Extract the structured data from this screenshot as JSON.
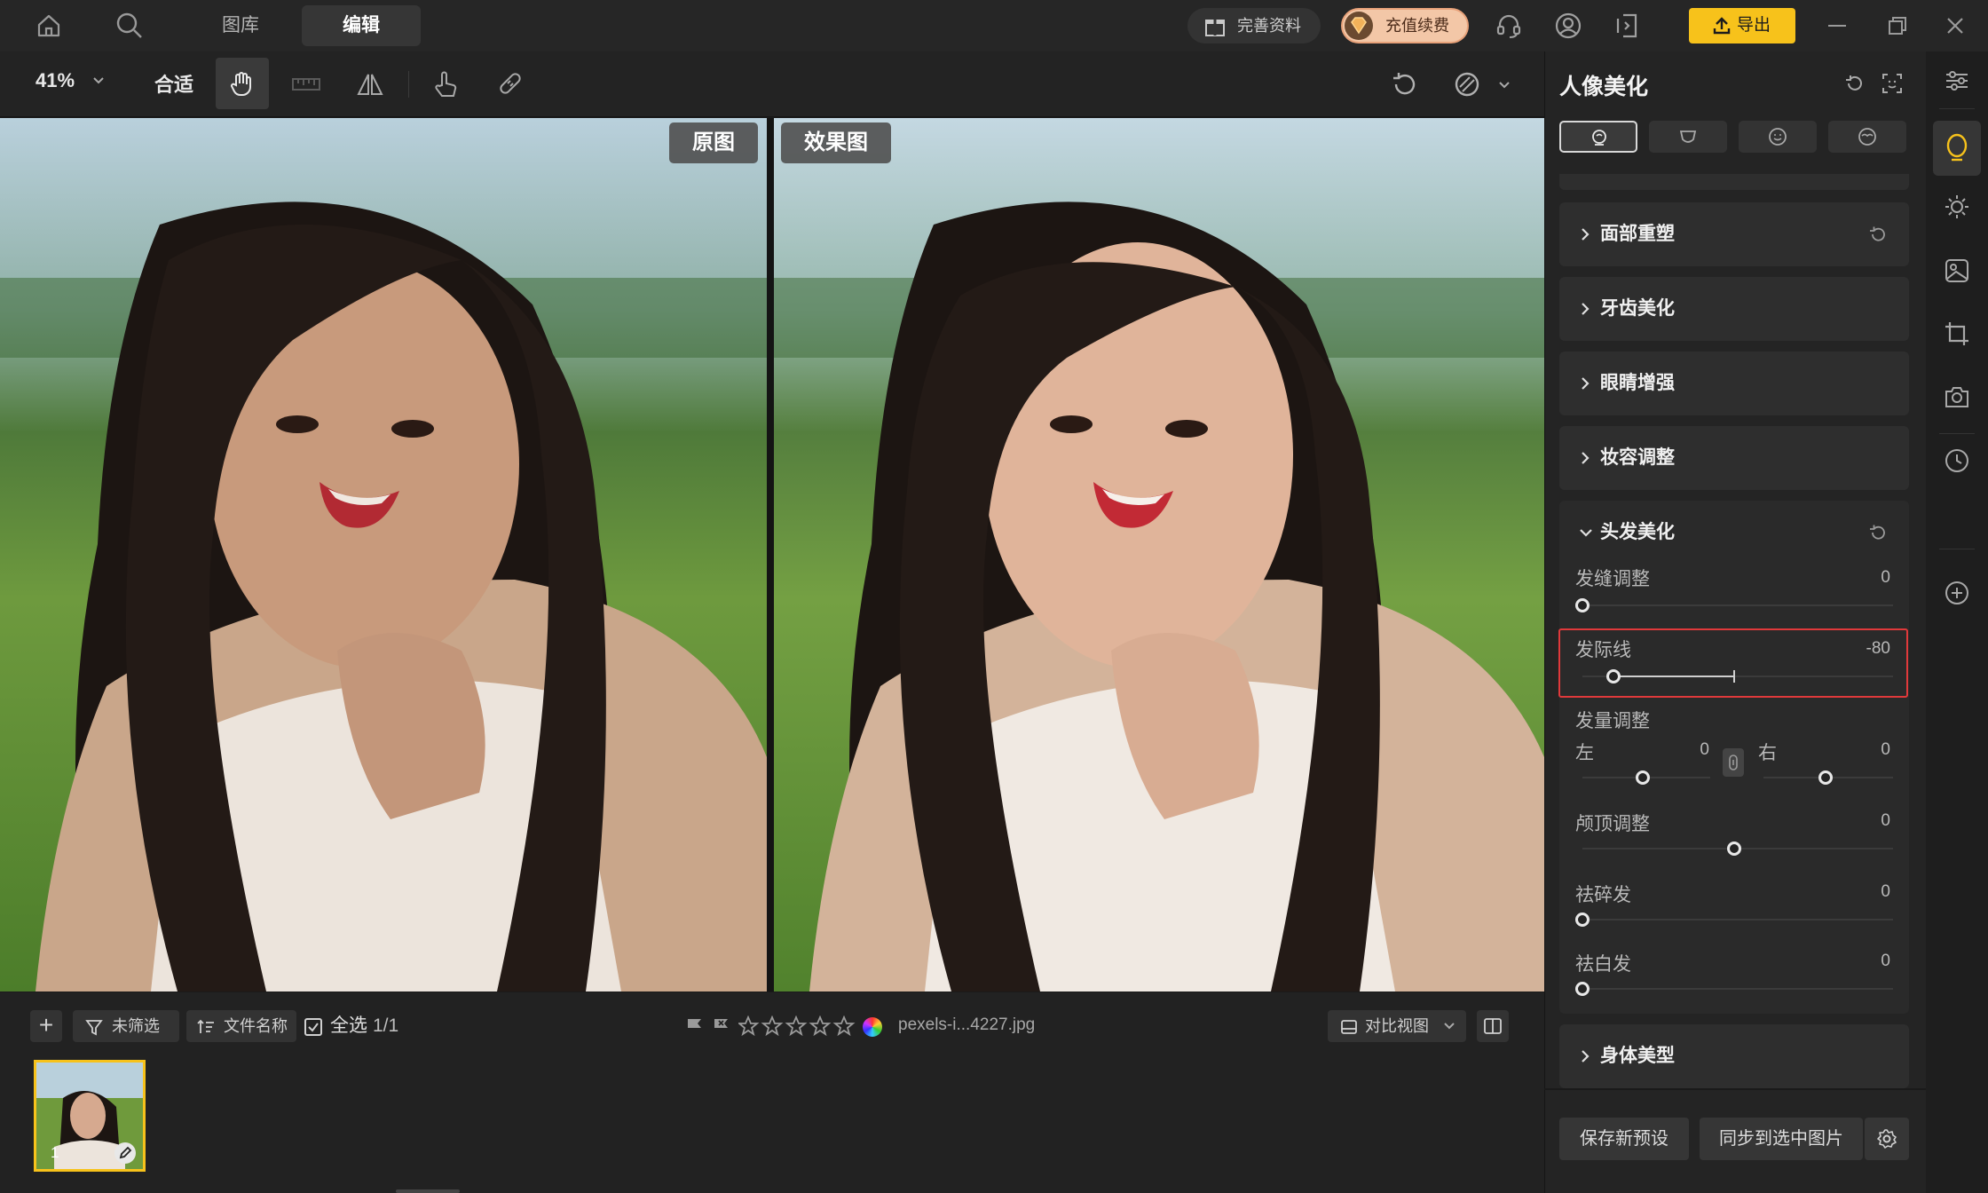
{
  "topbar": {
    "tabs": [
      {
        "label": "图库"
      },
      {
        "label": "编辑"
      }
    ],
    "complete_profile": "完善资料",
    "recharge": "充值续费",
    "export": "导出"
  },
  "toolbar": {
    "zoom": "41%",
    "fit": "合适"
  },
  "canvas": {
    "original_badge": "原图",
    "effect_badge": "效果图"
  },
  "bottom": {
    "filter": "未筛选",
    "sort": "文件名称",
    "select_all": "全选",
    "count": "1/1",
    "filename": "pexels-i...4227.jpg",
    "compare_view": "对比视图",
    "thumb_index": "1"
  },
  "panel": {
    "title": "人像美化",
    "sections": {
      "face": "面部重塑",
      "teeth": "牙齿美化",
      "eyes": "眼睛增强",
      "makeup": "妆容调整",
      "hair": "头发美化",
      "body": "身体美型"
    },
    "hair": {
      "part": {
        "label": "发缝调整",
        "value": "0"
      },
      "hairline": {
        "label": "发际线",
        "value": "-80"
      },
      "volume": {
        "label": "发量调整",
        "left_label": "左",
        "left_value": "0",
        "right_label": "右",
        "right_value": "0"
      },
      "crown": {
        "label": "颅顶调整",
        "value": "0"
      },
      "flyaway": {
        "label": "祛碎发",
        "value": "0"
      },
      "white": {
        "label": "祛白发",
        "value": "0"
      }
    },
    "save_preset": "保存新预设",
    "sync": "同步到选中图片"
  },
  "colors": {
    "accent": "#f7c21b",
    "highlight": "#e0393b"
  }
}
